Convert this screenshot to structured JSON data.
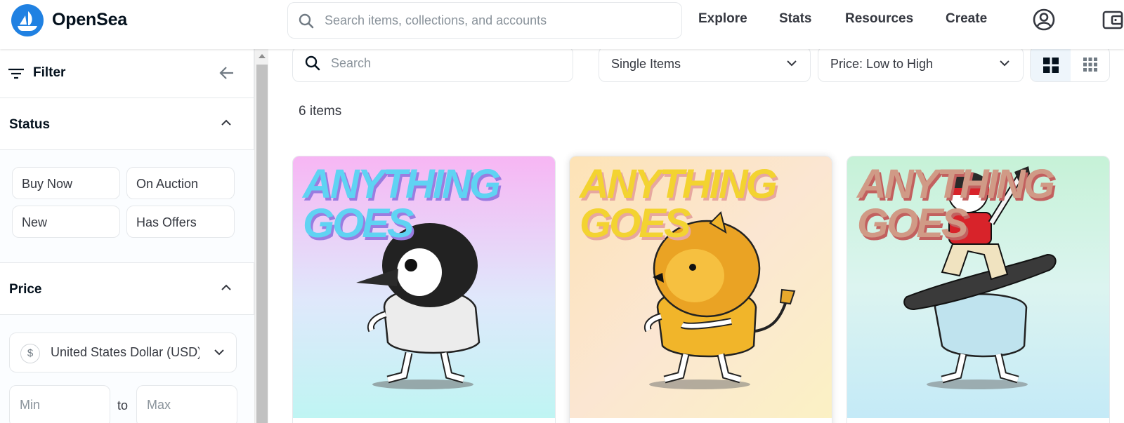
{
  "header": {
    "brand": "OpenSea",
    "search_placeholder": "Search items, collections, and accounts",
    "nav": {
      "explore": "Explore",
      "stats": "Stats",
      "resources": "Resources",
      "create": "Create"
    },
    "icons": [
      "opensea-logo-icon",
      "search-icon",
      "account-icon",
      "wallet-icon"
    ]
  },
  "sidebar": {
    "filter_title": "Filter",
    "status": {
      "title": "Status",
      "options": [
        "Buy Now",
        "On Auction",
        "New",
        "Has Offers"
      ]
    },
    "price": {
      "title": "Price",
      "currency_symbol": "$",
      "currency": "United States Dollar (USD)",
      "min_placeholder": "Min",
      "max_placeholder": "Max",
      "to_label": "to"
    }
  },
  "main": {
    "search_placeholder": "Search",
    "item_type": "Single Items",
    "sort": "Price: Low to High",
    "item_count": "6 items",
    "cards": [
      {
        "name": "penguin-card",
        "art_text": "ANYTHING GOES",
        "bg": "#f5b8f2",
        "title_color": "#5fd3f3"
      },
      {
        "name": "lion-card",
        "art_text": "ANYTHING GOES",
        "bg": "#fde4c2",
        "title_color": "#f3d331"
      },
      {
        "name": "snowboarder-card",
        "art_text": "ANYTHING GOES",
        "bg": "#c9f1de",
        "title_color": "#d09a86"
      }
    ]
  },
  "colors": {
    "brand_blue": "#2081e2",
    "text_dark": "#04111d",
    "border": "#e5e8eb"
  }
}
